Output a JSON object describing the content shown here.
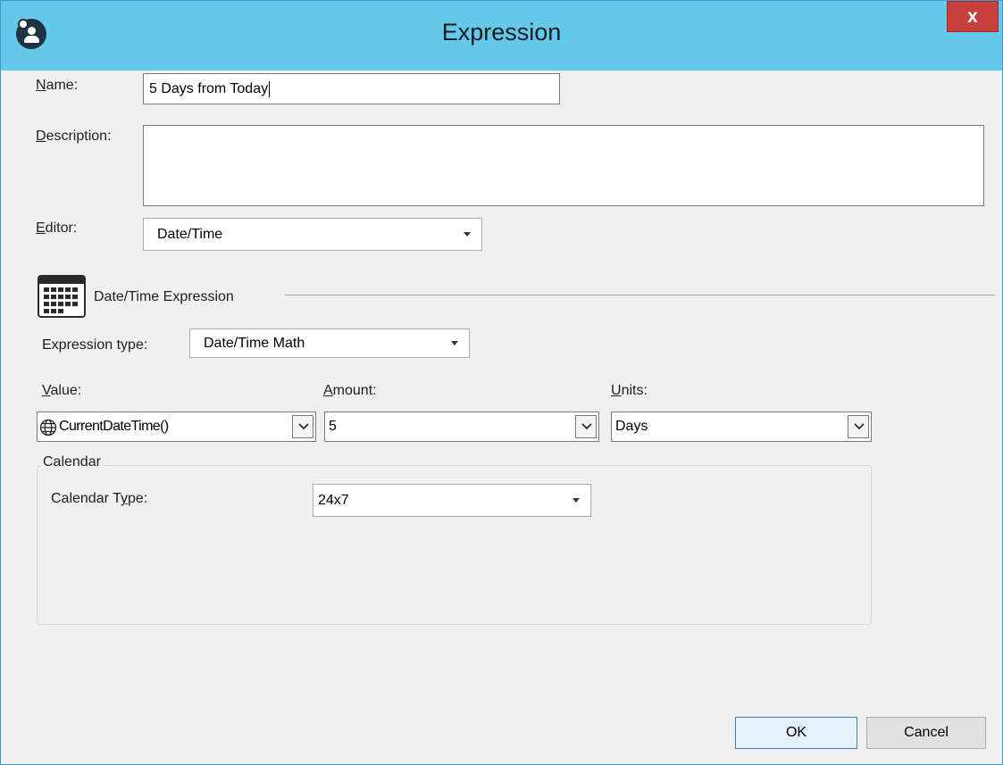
{
  "window": {
    "title": "Expression",
    "close_label": "x"
  },
  "form": {
    "name_label_underline": "N",
    "name_label_rest": "ame:",
    "name_value": "5 Days from Today",
    "description_label_underline": "D",
    "description_label_rest": "escription:",
    "description_value": "",
    "editor_label_underline": "E",
    "editor_label_rest": "ditor:",
    "editor_value": "Date/Time"
  },
  "section": {
    "title": "Date/Time Expression",
    "icon": "calendar-icon"
  },
  "expression": {
    "type_label": "Expression type:",
    "type_value": "Date/Time Math",
    "value_label_underline": "V",
    "value_label_rest": "alue:",
    "value_value": "CurrentDateTime()",
    "value_icon": "globe-icon",
    "amount_label_underline": "A",
    "amount_label_rest": "mount:",
    "amount_value": "5",
    "units_label_underline": "U",
    "units_label_rest": "nits:",
    "units_value": "Days"
  },
  "calendar": {
    "group_label": "Calendar",
    "type_label_pre": "Calendar T",
    "type_label_underline": "y",
    "type_label_post": "pe:",
    "type_value": "24x7"
  },
  "buttons": {
    "ok": "OK",
    "cancel": "Cancel"
  },
  "colors": {
    "titlebar": "#63c8ea",
    "close": "#c7403d",
    "dialog_bg": "#f0f0f0"
  }
}
